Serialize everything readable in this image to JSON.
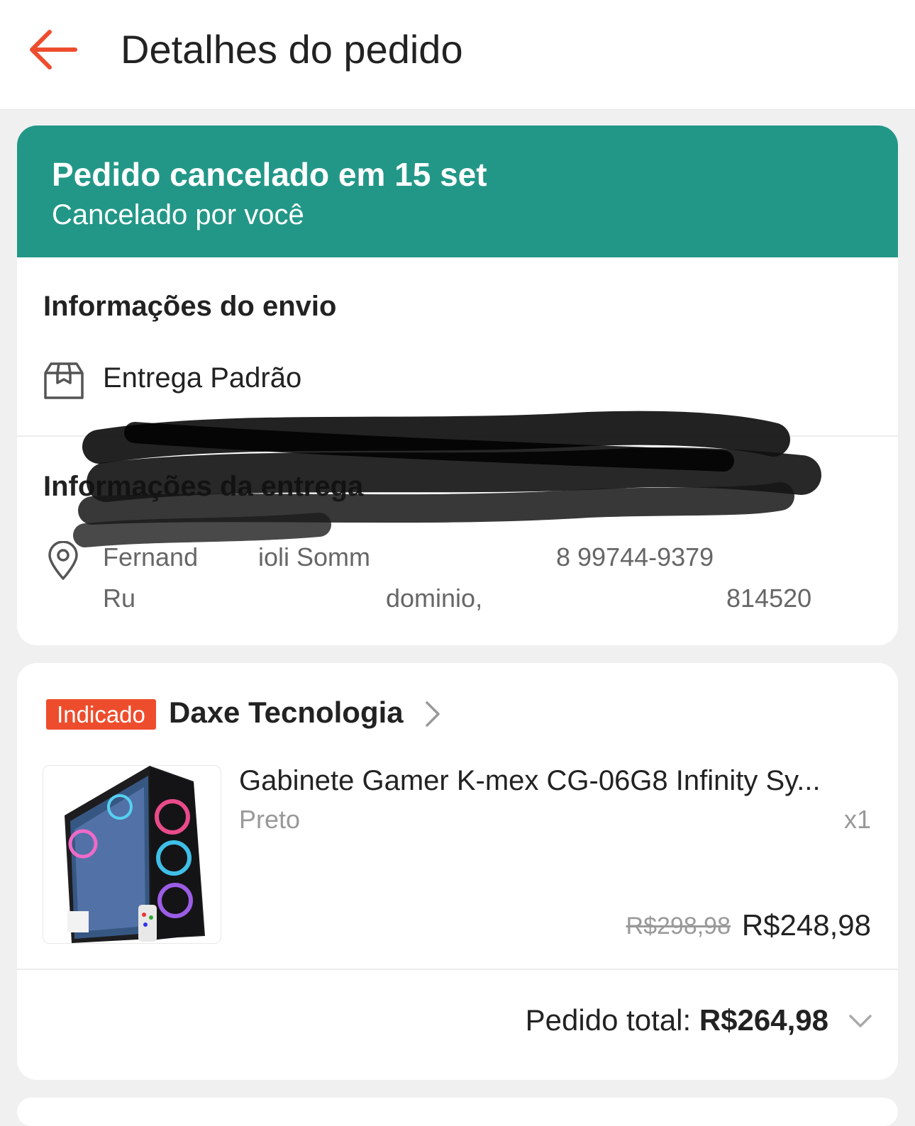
{
  "header": {
    "title": "Detalhes do pedido",
    "back_icon": "arrow-left-icon",
    "accent_color": "#ee4d2d"
  },
  "status": {
    "title": "Pedido cancelado em 15 set",
    "subtitle": "Cancelado por você",
    "color": "#229787"
  },
  "shipping": {
    "section_title": "Informações do envio",
    "method": "Entrega Padrão",
    "icon": "package-box-icon"
  },
  "delivery": {
    "section_title": "Informações da entrega",
    "icon": "location-pin-icon",
    "line1_visible_start": "Fernand",
    "line1_visible_mid": "ioli Somm",
    "line1_visible_end": "8 99744-9379",
    "line2_visible_start": "Ru",
    "line2_visible_mid": "dominio,",
    "line2_visible_end": "814520",
    "redacted": true
  },
  "shop": {
    "badge": "Indicado",
    "name": "Daxe Tecnologia",
    "chevron_icon": "chevron-right-icon"
  },
  "product": {
    "name": "Gabinete Gamer K-mex CG-06G8 Infinity Sy...",
    "variant": "Preto",
    "quantity": "x1",
    "price_original": "R$298,98",
    "price_current": "R$248,98",
    "image": "pc-case-rgb-product-image"
  },
  "order_total": {
    "label": "Pedido total: ",
    "value": "R$264,98",
    "expand_icon": "chevron-down-icon"
  }
}
